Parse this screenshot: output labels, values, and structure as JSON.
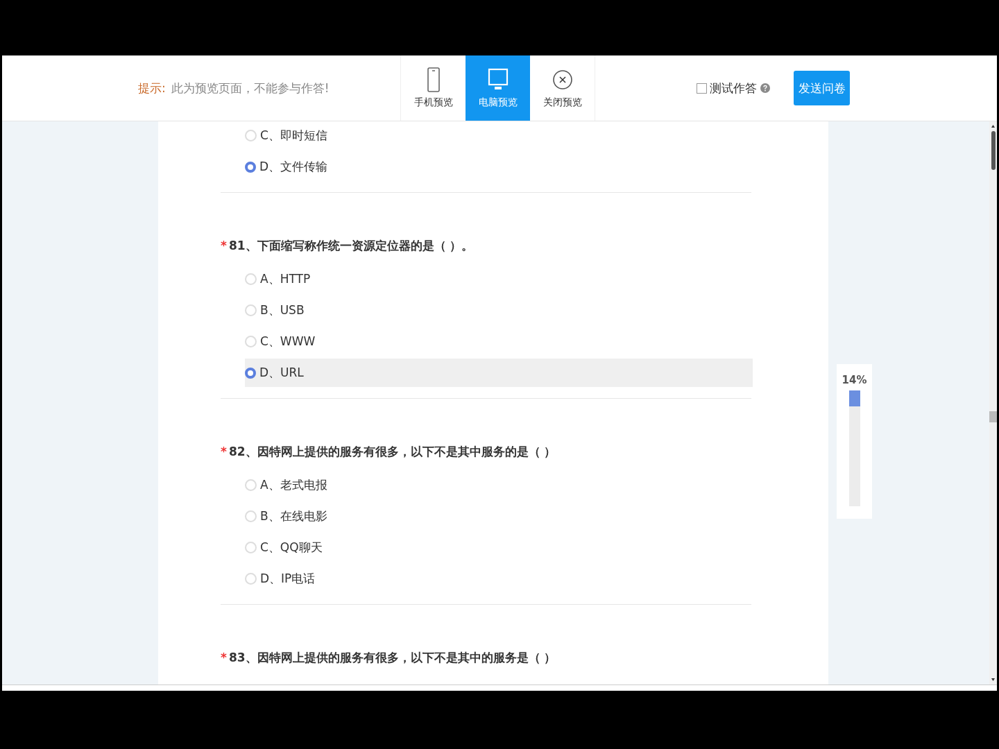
{
  "header": {
    "hint_label": "提示:",
    "hint_text": "此为预览页面，不能参与作答!",
    "tabs": [
      {
        "label": "手机预览",
        "kind": "phone",
        "selected": false
      },
      {
        "label": "电脑预览",
        "kind": "monitor",
        "selected": true
      },
      {
        "label": "关闭预览",
        "kind": "close",
        "selected": false
      }
    ],
    "test_answer": {
      "label": "测试作答",
      "checked": false
    },
    "send_button": "发送问卷"
  },
  "questions": [
    {
      "options": [
        {
          "text": "C、即时短信",
          "selected": false,
          "hovered": false
        },
        {
          "text": "D、文件传输",
          "selected": true,
          "hovered": false
        }
      ]
    },
    {
      "required_mark": "*",
      "title": "81、下面缩写称作统一资源定位器的是（   ）。",
      "options": [
        {
          "text": "A、HTTP",
          "selected": false,
          "hovered": false
        },
        {
          "text": "B、USB",
          "selected": false,
          "hovered": false
        },
        {
          "text": "C、WWW",
          "selected": false,
          "hovered": false
        },
        {
          "text": "D、URL",
          "selected": true,
          "hovered": true
        }
      ]
    },
    {
      "required_mark": "*",
      "title": "82、因特网上提供的服务有很多，以下不是其中服务的是（    ）",
      "options": [
        {
          "text": "A、老式电报",
          "selected": false,
          "hovered": false
        },
        {
          "text": "B、在线电影",
          "selected": false,
          "hovered": false
        },
        {
          "text": "C、QQ聊天",
          "selected": false,
          "hovered": false
        },
        {
          "text": "D、IP电话",
          "selected": false,
          "hovered": false
        }
      ]
    },
    {
      "required_mark": "*",
      "title": "83、因特网上提供的服务有很多，以下不是其中的服务是（ ）"
    }
  ],
  "progress": {
    "label": "14%",
    "level": 0.14
  }
}
